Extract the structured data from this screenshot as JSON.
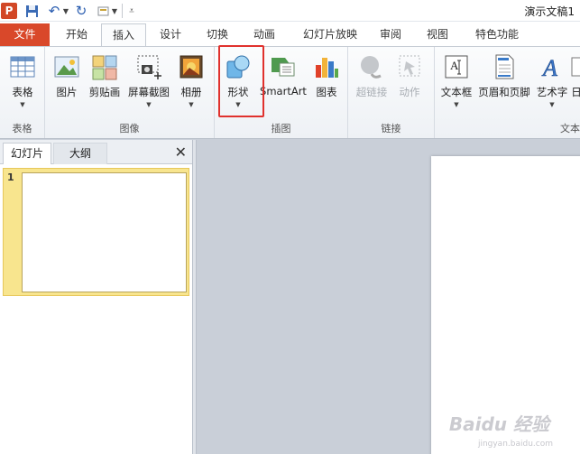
{
  "quick_access": {
    "app_logo": "P",
    "doc_title": "演示文稿1"
  },
  "tabs": [
    {
      "label": "文件"
    },
    {
      "label": "开始"
    },
    {
      "label": "插入"
    },
    {
      "label": "设计"
    },
    {
      "label": "切换"
    },
    {
      "label": "动画"
    },
    {
      "label": "幻灯片放映"
    },
    {
      "label": "审阅"
    },
    {
      "label": "视图"
    },
    {
      "label": "特色功能"
    }
  ],
  "ribbon": {
    "groups": [
      {
        "label": "表格",
        "buttons": [
          {
            "label": "表格",
            "icon": "table-icon"
          }
        ]
      },
      {
        "label": "图像",
        "buttons": [
          {
            "label": "图片",
            "icon": "picture-icon"
          },
          {
            "label": "剪贴画",
            "icon": "clipart-icon"
          },
          {
            "label": "屏幕截图",
            "icon": "screenshot-icon"
          },
          {
            "label": "相册",
            "icon": "photo-album-icon"
          }
        ]
      },
      {
        "label": "插图",
        "buttons": [
          {
            "label": "形状",
            "icon": "shapes-icon"
          },
          {
            "label": "SmartArt",
            "icon": "smartart-icon"
          },
          {
            "label": "图表",
            "icon": "chart-icon"
          }
        ]
      },
      {
        "label": "链接",
        "buttons": [
          {
            "label": "超链接",
            "icon": "hyperlink-icon"
          },
          {
            "label": "动作",
            "icon": "action-icon"
          }
        ]
      },
      {
        "label": "文本",
        "buttons": [
          {
            "label": "文本框",
            "icon": "textbox-icon"
          },
          {
            "label": "页眉和页脚",
            "icon": "header-footer-icon"
          },
          {
            "label": "艺术字",
            "icon": "wordart-icon"
          },
          {
            "label": "日",
            "icon": "date-icon"
          }
        ]
      }
    ]
  },
  "slides_pane": {
    "tab_slides": "幻灯片",
    "tab_outline": "大纲",
    "close_glyph": "✕",
    "thumbs": [
      {
        "number": "1"
      }
    ]
  },
  "watermark": {
    "text": "Baidu 经验",
    "sub": "jingyan.baidu.com"
  },
  "colors": {
    "file_tab": "#d9482a",
    "highlight": "#e0312d",
    "selected_thumb": "#f8e58e"
  }
}
